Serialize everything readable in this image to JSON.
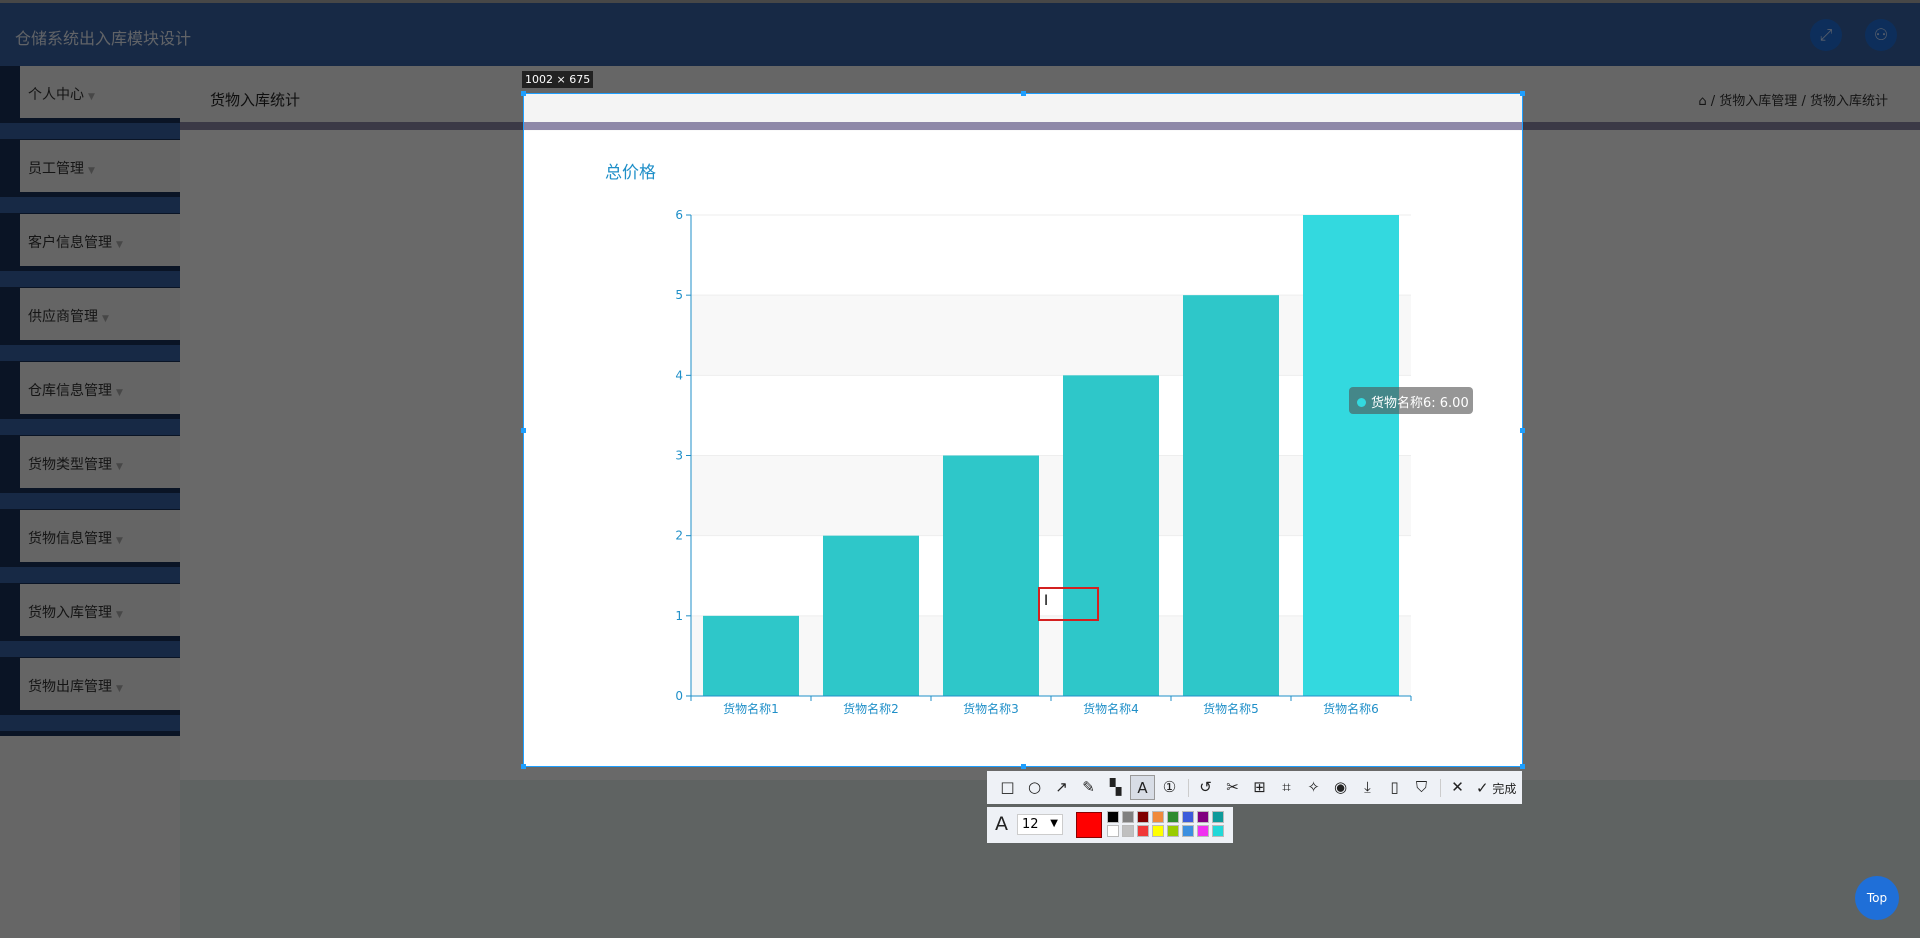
{
  "header": {
    "title": "仓储系统出入库模块设计",
    "fullscreen_icon": "expand-icon",
    "user_icon": "user-icon"
  },
  "sidebar": {
    "items": [
      {
        "label": "个人中心"
      },
      {
        "label": "员工管理"
      },
      {
        "label": "客户信息管理"
      },
      {
        "label": "供应商管理"
      },
      {
        "label": "仓库信息管理"
      },
      {
        "label": "货物类型管理"
      },
      {
        "label": "货物信息管理"
      },
      {
        "label": "货物入库管理"
      },
      {
        "label": "货物出库管理"
      }
    ]
  },
  "page": {
    "title": "货物入库统计",
    "breadcrumb": [
      "货物入库管理",
      "货物入库统计"
    ],
    "separator": "/",
    "top_button": "Top"
  },
  "capture": {
    "size_label": "1002 × 675",
    "font_size": "12",
    "done_label": "完成",
    "current_color": "#ff0000",
    "palette": [
      "#000000",
      "#808080",
      "#800000",
      "#f08a3c",
      "#2e8b2e",
      "#3b5bdb",
      "#800080",
      "#0e9a9a",
      "#ffffff",
      "#c0c0c0",
      "#f03838",
      "#ffff00",
      "#99cc00",
      "#3c8fe0",
      "#f030f0",
      "#22d8d8"
    ]
  },
  "chart_data": {
    "type": "bar",
    "title": "总价格",
    "categories": [
      "货物名称1",
      "货物名称2",
      "货物名称3",
      "货物名称4",
      "货物名称5",
      "货物名称6"
    ],
    "values": [
      1,
      2,
      3,
      4,
      5,
      6
    ],
    "ylim": [
      0,
      6
    ],
    "yticks": [
      0,
      1,
      2,
      3,
      4,
      5,
      6
    ],
    "grid": true,
    "bar_color": "#2ec7c9",
    "highlight_color": "#33d9df",
    "tooltip": {
      "label": "货物名称6: 6.00"
    }
  }
}
